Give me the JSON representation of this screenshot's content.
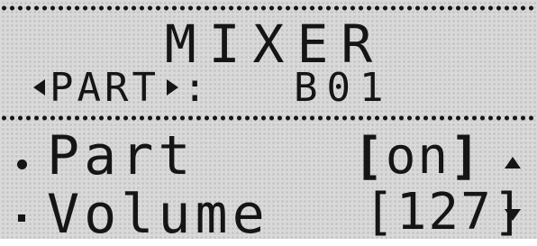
{
  "screen": {
    "title": "MIXER",
    "part_selector": {
      "label": "PART",
      "separator": ":",
      "value": "B01"
    },
    "rows": [
      {
        "label": "Part",
        "value": "on",
        "bracket_open": "[",
        "bracket_close": "]",
        "selected": true
      },
      {
        "label": "Volume",
        "value": "127",
        "bracket_open": "[",
        "bracket_close": "]",
        "selected": false
      }
    ]
  },
  "colors": {
    "lcd_background": "#d9d9d9",
    "lcd_ink": "#151515"
  },
  "icons": [
    "left-arrow-icon",
    "right-arrow-icon",
    "selection-marker-icon",
    "scroll-up-icon",
    "scroll-down-icon"
  ]
}
